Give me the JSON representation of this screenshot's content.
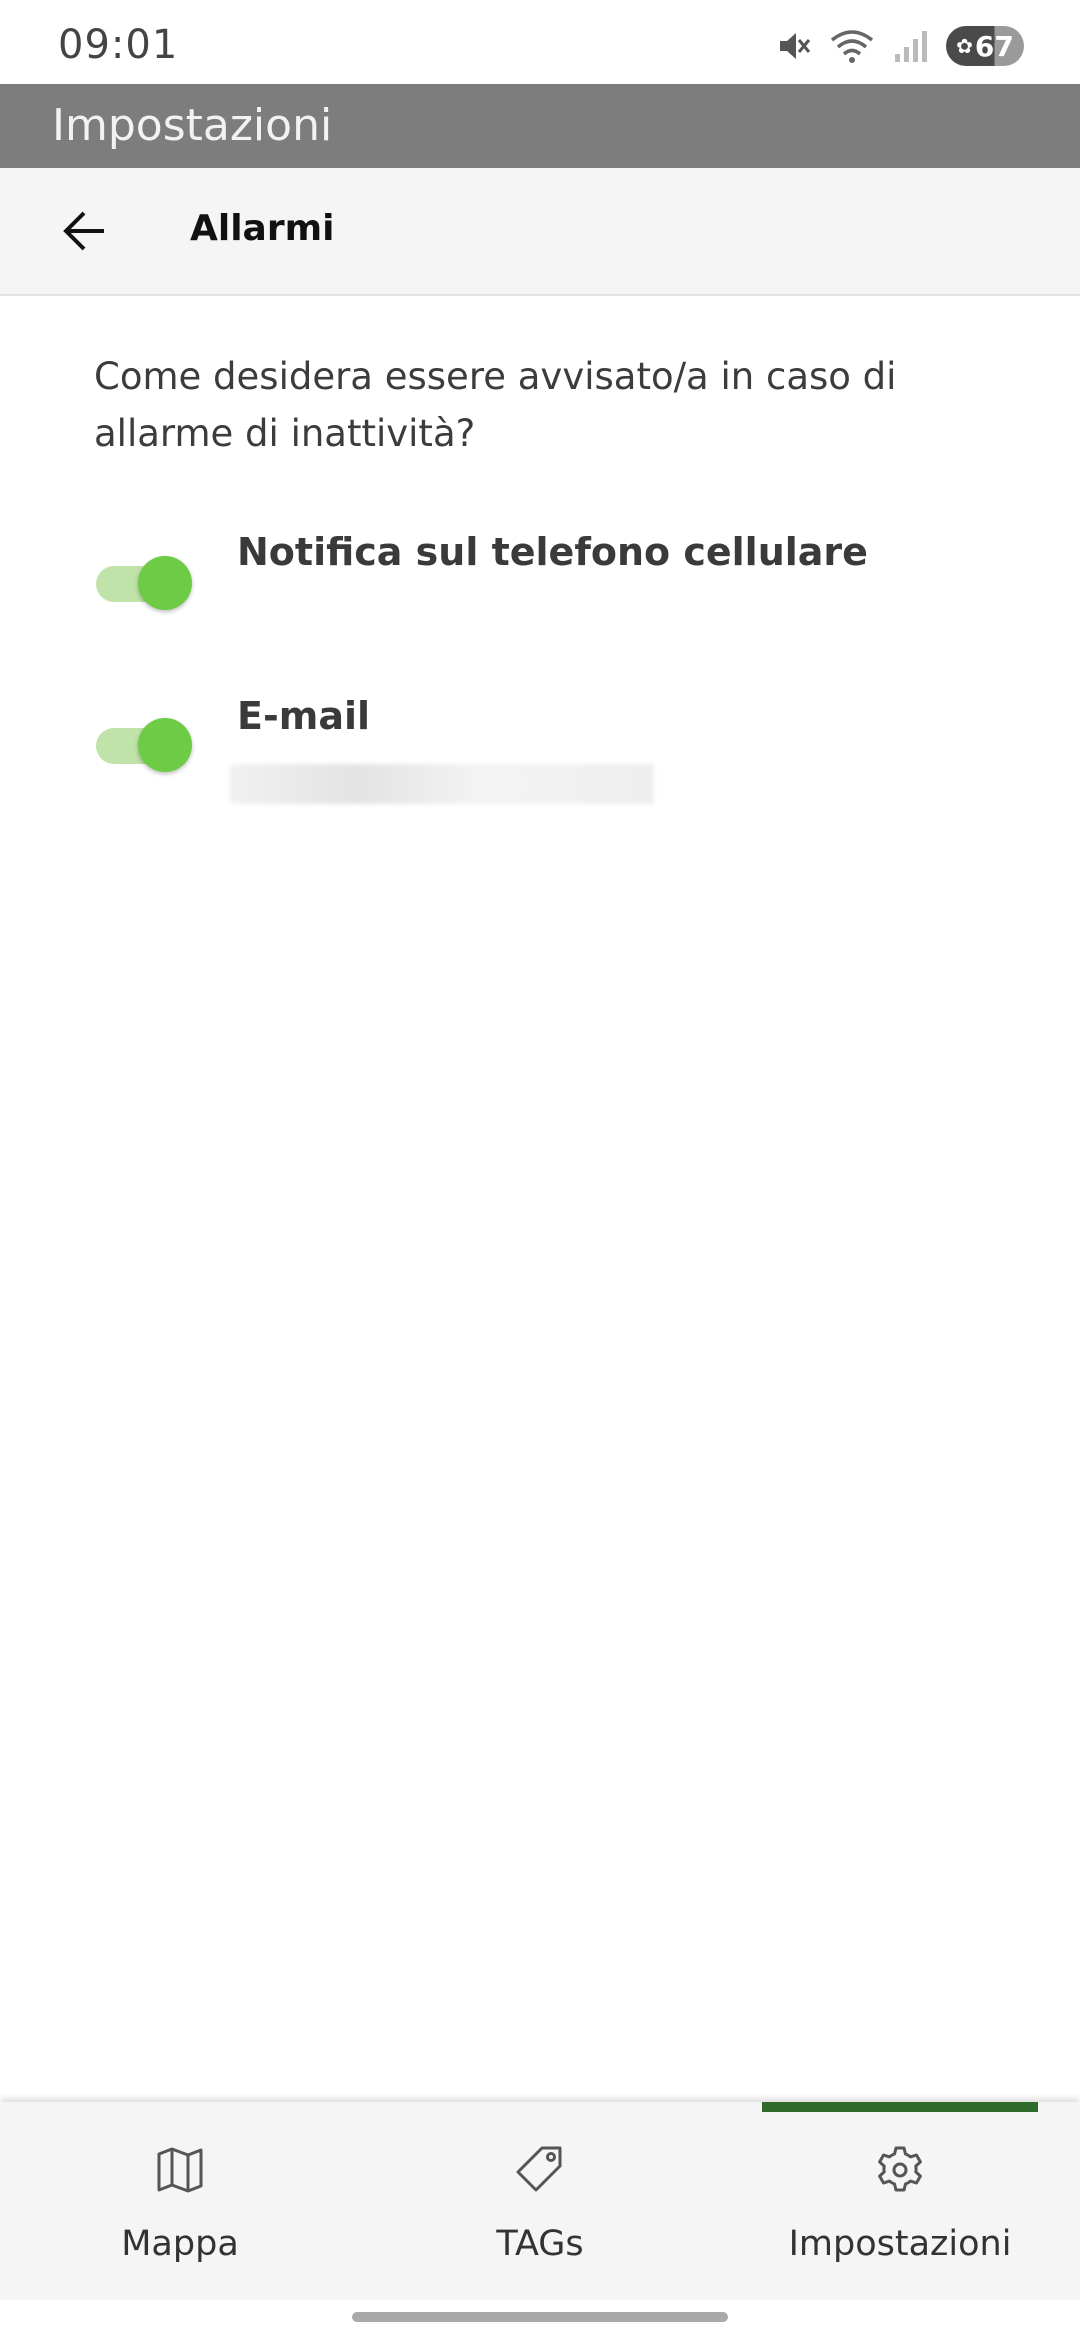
{
  "status_bar": {
    "time": "09:01",
    "battery_level": "67",
    "icons": [
      "mute-icon",
      "wifi-icon",
      "signal-icon",
      "battery-icon"
    ]
  },
  "app_bar": {
    "title": "Impostazioni"
  },
  "sub_header": {
    "back_icon": "arrow-left-icon",
    "title": "Allarmi"
  },
  "content": {
    "question": "Come desidera essere avvisato/a in caso di allarme di inattività?",
    "options": [
      {
        "label": "Notifica sul telefono cellulare",
        "enabled": true
      },
      {
        "label": "E-mail",
        "enabled": true
      }
    ]
  },
  "bottom_nav": {
    "items": [
      {
        "label": "Mappa",
        "icon": "map-icon",
        "selected": false
      },
      {
        "label": "TAGs",
        "icon": "tag-icon",
        "selected": false
      },
      {
        "label": "Impostazioni",
        "icon": "gear-icon",
        "selected": true
      }
    ]
  },
  "colors": {
    "app_bar": "#7d7d7d",
    "toggle_on_thumb": "#6dcb45",
    "toggle_on_track": "#bfe3a8",
    "nav_indicator": "#2e6b2a"
  }
}
